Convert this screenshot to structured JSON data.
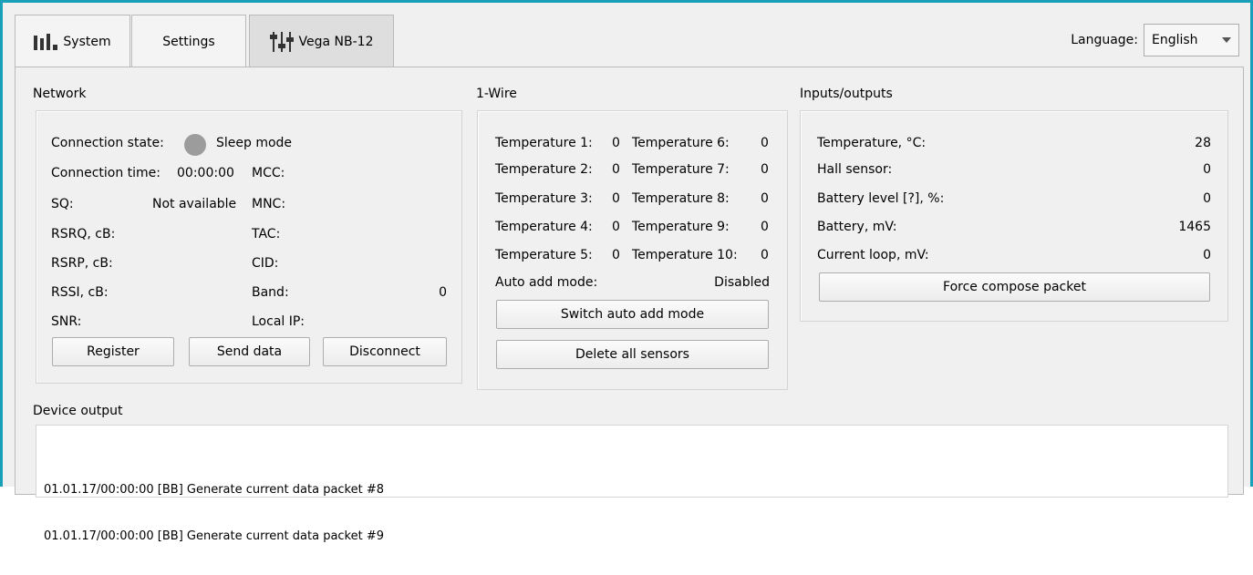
{
  "tabs": [
    {
      "label": "System",
      "icon": "bar-chart-icon"
    },
    {
      "label": "Settings",
      "icon": ""
    },
    {
      "label": "Vega NB-12",
      "icon": "sliders-icon"
    }
  ],
  "language": {
    "label": "Language:",
    "value": "English"
  },
  "network": {
    "title": "Network",
    "connection_state_label": "Connection state:",
    "connection_state_value": "Sleep mode",
    "connection_time_label": "Connection time:",
    "connection_time_value": "00:00:00",
    "sq_label": "SQ:",
    "sq_value": "Not available",
    "rsrq_label": "RSRQ, cB:",
    "rsrp_label": "RSRP, cB:",
    "rssi_label": "RSSI, cB:",
    "snr_label": "SNR:",
    "mcc_label": "MCC:",
    "mnc_label": "MNC:",
    "tac_label": "TAC:",
    "cid_label": "CID:",
    "band_label": "Band:",
    "band_value": "0",
    "local_ip_label": "Local IP:",
    "buttons": {
      "register": "Register",
      "send_data": "Send data",
      "disconnect": "Disconnect"
    }
  },
  "onewire": {
    "title": "1-Wire",
    "rows": [
      {
        "left_label": "Temperature 1:",
        "left_value": "0",
        "right_label": "Temperature 6:",
        "right_value": "0"
      },
      {
        "left_label": "Temperature 2:",
        "left_value": "0",
        "right_label": "Temperature 7:",
        "right_value": "0"
      },
      {
        "left_label": "Temperature 3:",
        "left_value": "0",
        "right_label": "Temperature 8:",
        "right_value": "0"
      },
      {
        "left_label": "Temperature 4:",
        "left_value": "0",
        "right_label": "Temperature 9:",
        "right_value": "0"
      },
      {
        "left_label": "Temperature 5:",
        "left_value": "0",
        "right_label": "Temperature 10:",
        "right_value": "0"
      }
    ],
    "auto_add_label": "Auto add mode:",
    "auto_add_value": "Disabled",
    "buttons": {
      "switch_auto": "Switch auto add mode",
      "delete_all": "Delete all sensors"
    }
  },
  "io": {
    "title": "Inputs/outputs",
    "rows": [
      {
        "label": "Temperature, °C:",
        "value": "28"
      },
      {
        "label": "Hall sensor:",
        "value": "0"
      },
      {
        "label": "Battery level [?], %:",
        "value": "0"
      },
      {
        "label": "Battery, mV:",
        "value": "1465"
      },
      {
        "label": "Current loop, mV:",
        "value": "0"
      }
    ],
    "buttons": {
      "force": "Force compose packet"
    }
  },
  "device_output": {
    "title": "Device output",
    "lines": [
      "01.01.17/00:00:00 [BB] Generate current data packet #8",
      "01.01.17/00:00:00 [BB] Generate current data packet #9"
    ]
  },
  "colors": {
    "window_border": "#1a9fb8",
    "status_dot": "#9c9c9c"
  }
}
